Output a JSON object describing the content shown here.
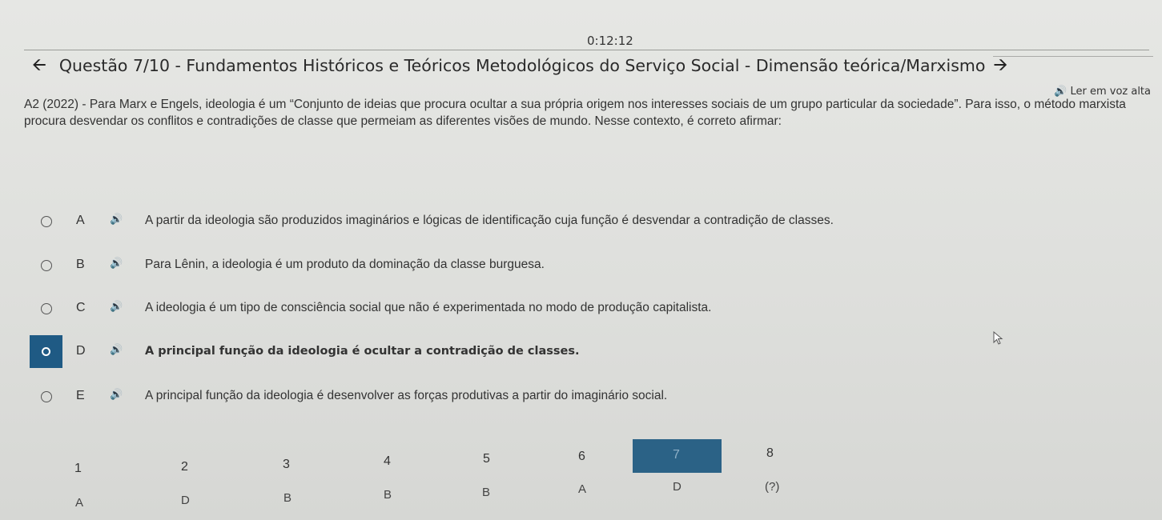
{
  "timer": "0:12:12",
  "header": {
    "back_icon": "arrow-left-icon",
    "title": "Questão 7/10 - Fundamentos Históricos e Teóricos Metodológicos do Serviço Social - Dimensão teórica/Marxismo",
    "next_icon": "arrow-right-icon"
  },
  "tts": {
    "icon": "speaker-icon",
    "label": "Ler em voz alta"
  },
  "question": {
    "text": "A2 (2022) - Para Marx e Engels, ideologia é um “Conjunto de ideias que procura ocultar a sua própria origem nos interesses sociais de um grupo particular da sociedade”. Para isso, o método marxista procura desvendar os conflitos e contradições de classe que permeiam as diferentes visões de mundo. Nesse contexto, é correto afirmar:"
  },
  "options": [
    {
      "letter": "A",
      "text": "A partir da ideologia são produzidos imaginários e lógicas de identificação cuja função é desvendar a contradição de classes.",
      "selected": false
    },
    {
      "letter": "B",
      "text": "Para Lênin, a ideologia é um produto da dominação da classe burguesa.",
      "selected": false
    },
    {
      "letter": "C",
      "text": "A ideologia é um tipo de consciência social que não é experimentada no modo de produção capitalista.",
      "selected": false
    },
    {
      "letter": "D",
      "text": "A principal função da ideologia é ocultar a contradição de classes.",
      "selected": true
    },
    {
      "letter": "E",
      "text": "A principal função da ideologia é desenvolver as forças produtivas a partir do imaginário social.",
      "selected": false
    }
  ],
  "navigator": {
    "numbers": [
      "1",
      "2",
      "3",
      "4",
      "5",
      "6",
      "7",
      "8"
    ],
    "answers": [
      "A",
      "D",
      "B",
      "B",
      "B",
      "A",
      "D",
      "(?)"
    ],
    "current": "7",
    "current_color": "#2b6286"
  },
  "colors": {
    "selected": "#1f5a84",
    "background": "#dedfdc"
  }
}
